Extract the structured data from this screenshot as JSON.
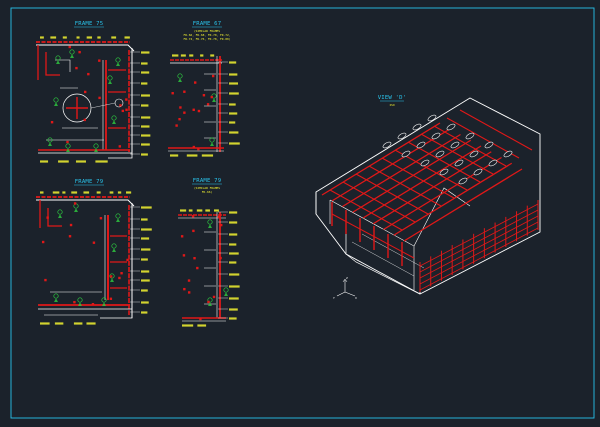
{
  "drawing": {
    "background": "#1b222b",
    "border_color": "#29c4ec",
    "detail_colors": {
      "steel": "#e01818",
      "member": "#ffffff",
      "text": "#f2f230",
      "callout": "#2ecc40",
      "title": "#29c4ec"
    },
    "views": [
      {
        "id": "frame75",
        "title": "FRAME 75",
        "subtitle": ""
      },
      {
        "id": "frame67",
        "title": "FRAME 67",
        "subtitle": "(SIMILAR FRAMES\nFR.66, FR.68, FR.70, FR.72,\nFR.74, FR.76, FR.78, FR.80)"
      },
      {
        "id": "frame79",
        "title": "FRAME 79",
        "subtitle": ""
      },
      {
        "id": "frame79b",
        "title": "FRAME 79",
        "subtitle": "(SIMILAR FRAMES\nFR.66)"
      },
      {
        "id": "view",
        "title": "VIEW 'D'",
        "subtitle": "ISO"
      }
    ]
  }
}
